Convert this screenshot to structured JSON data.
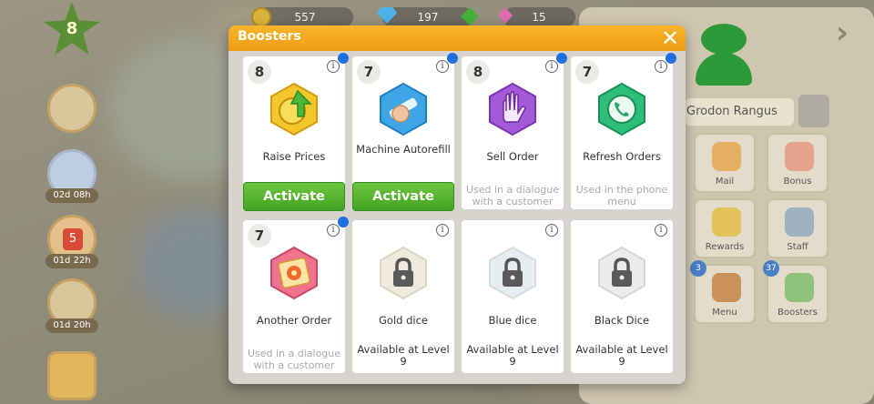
{
  "hud": {
    "level": "8",
    "coins": "557",
    "gems": "197",
    "tokens": "15",
    "timers": [
      "02d 08h",
      "01d 22h",
      "01d 20h"
    ],
    "calendar_day": "5"
  },
  "profile": {
    "name": "Grodon Rangus"
  },
  "menu_tiles": [
    {
      "label": "Mail",
      "badge": ""
    },
    {
      "label": "Bonus",
      "badge": ""
    },
    {
      "label": "Rewards",
      "badge": ""
    },
    {
      "label": "Staff",
      "badge": ""
    },
    {
      "label": "Menu",
      "badge": "3"
    },
    {
      "label": "Boosters",
      "badge": "37"
    }
  ],
  "dialog": {
    "title": "Boosters",
    "close_label": "✕"
  },
  "boosters": [
    {
      "count": "8",
      "name": "Raise Prices",
      "action": "Activate",
      "note": "",
      "icon": "coin-arrow-icon",
      "color": "#f2c72b"
    },
    {
      "count": "7",
      "name": "Machine Autorefill",
      "action": "Activate",
      "note": "",
      "icon": "hand-hammer-icon",
      "color": "#3fa6e6"
    },
    {
      "count": "8",
      "name": "Sell Order",
      "action": "",
      "note": "Used in a dialogue with a customer",
      "icon": "hand-icon",
      "color": "#a25ad9"
    },
    {
      "count": "7",
      "name": "Refresh Orders",
      "action": "",
      "note": "Used in the phone menu",
      "icon": "phone-icon",
      "color": "#2dbf7a"
    },
    {
      "count": "7",
      "name": "Another Order",
      "action": "",
      "note": "Used in a dialogue with a customer",
      "icon": "cog-card-icon",
      "color": "#f0738d"
    },
    {
      "count": "",
      "name": "Gold dice",
      "action": "",
      "note": "Available at Level 9",
      "icon": "lock-icon",
      "color": "#e8e4cf"
    },
    {
      "count": "",
      "name": "Blue dice",
      "action": "",
      "note": "Available at Level 9",
      "icon": "lock-icon",
      "color": "#dfe7ec"
    },
    {
      "count": "",
      "name": "Black Dice",
      "action": "",
      "note": "Available at Level 9",
      "icon": "lock-icon",
      "color": "#e6e6e6"
    }
  ],
  "info_label": "i"
}
